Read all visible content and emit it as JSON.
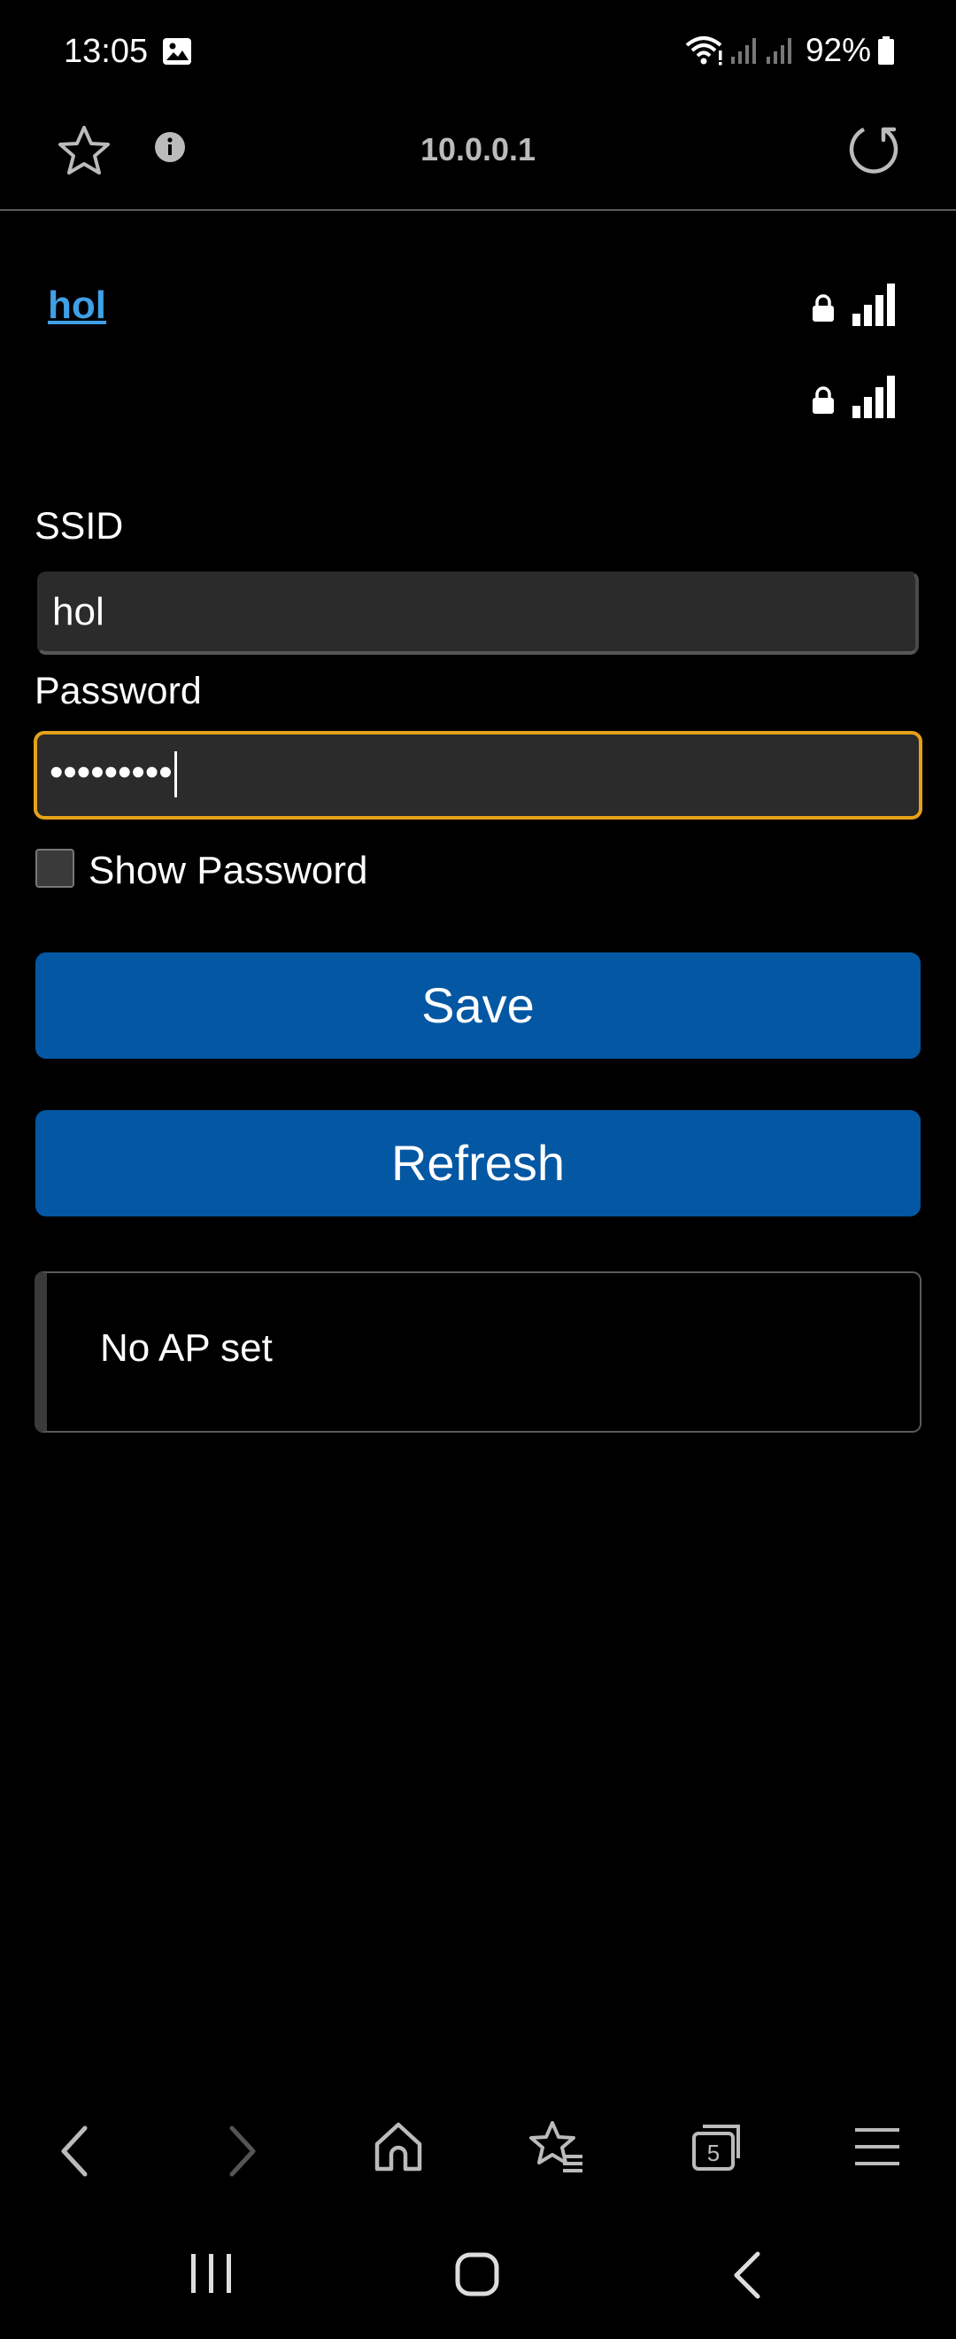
{
  "status_bar": {
    "time": "13:05",
    "battery": "92%",
    "icons": [
      "gallery-icon",
      "wifi-icon",
      "signal-icon",
      "signal-icon",
      "battery-icon"
    ]
  },
  "toolbar": {
    "url": "10.0.0.1",
    "icons": [
      "star-icon",
      "info-icon",
      "reload-icon"
    ]
  },
  "networks": [
    {
      "ssid": "hol",
      "icons": [
        "lock-icon",
        "signal-icon"
      ]
    },
    {
      "ssid": "",
      "icons": [
        "lock-icon",
        "signal-icon"
      ]
    }
  ],
  "form": {
    "ssid_label": "SSID",
    "ssid_value": "hol",
    "password_label": "Password",
    "password_value": "•••••••••",
    "show_password_label": "Show Password",
    "show_password_checked": false
  },
  "buttons": {
    "save": "Save",
    "refresh": "Refresh"
  },
  "status": {
    "message": "No AP set"
  },
  "browser_bottom_bar": {
    "icons": [
      "back-icon",
      "forward-icon",
      "home-icon",
      "bookmarks-icon",
      "tabs-icon",
      "menu-icon"
    ],
    "tab_count": "5"
  },
  "system_nav": {
    "icons": [
      "recents-icon",
      "home-circle-icon",
      "back-icon"
    ]
  },
  "colors": {
    "background": "#000000",
    "link": "#3fa0e6",
    "button": "#0357a3",
    "focus_border": "#e6a11a",
    "input_bg": "#2b2b2b"
  }
}
